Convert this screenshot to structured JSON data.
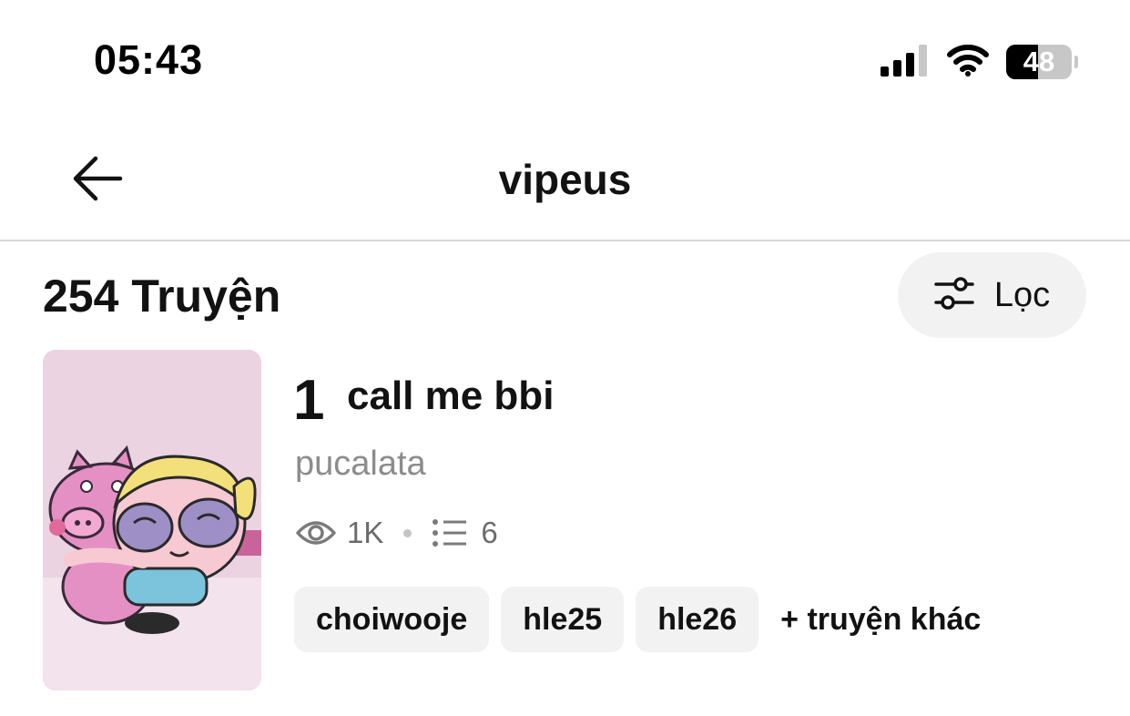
{
  "status_bar": {
    "time": "05:43",
    "battery": "48",
    "battery_level": 0.48
  },
  "header": {
    "title": "vipeus",
    "back_icon": "arrow-left-icon"
  },
  "list_header": {
    "count_label": "254 Truyện",
    "filter_label": "Lọc",
    "filter_icon": "sliders-icon"
  },
  "story": {
    "rank": "1",
    "title": "call me bbi",
    "author": "pucalata",
    "views": "1K",
    "parts": "6",
    "tags": [
      "choiwooje",
      "hle25",
      "hle26"
    ],
    "more_tags_label": "+ truyện khác"
  },
  "colors": {
    "background": "#ffffff",
    "text": "#121212",
    "muted": "#8c8c8c",
    "chip": "#f2f2f2"
  }
}
